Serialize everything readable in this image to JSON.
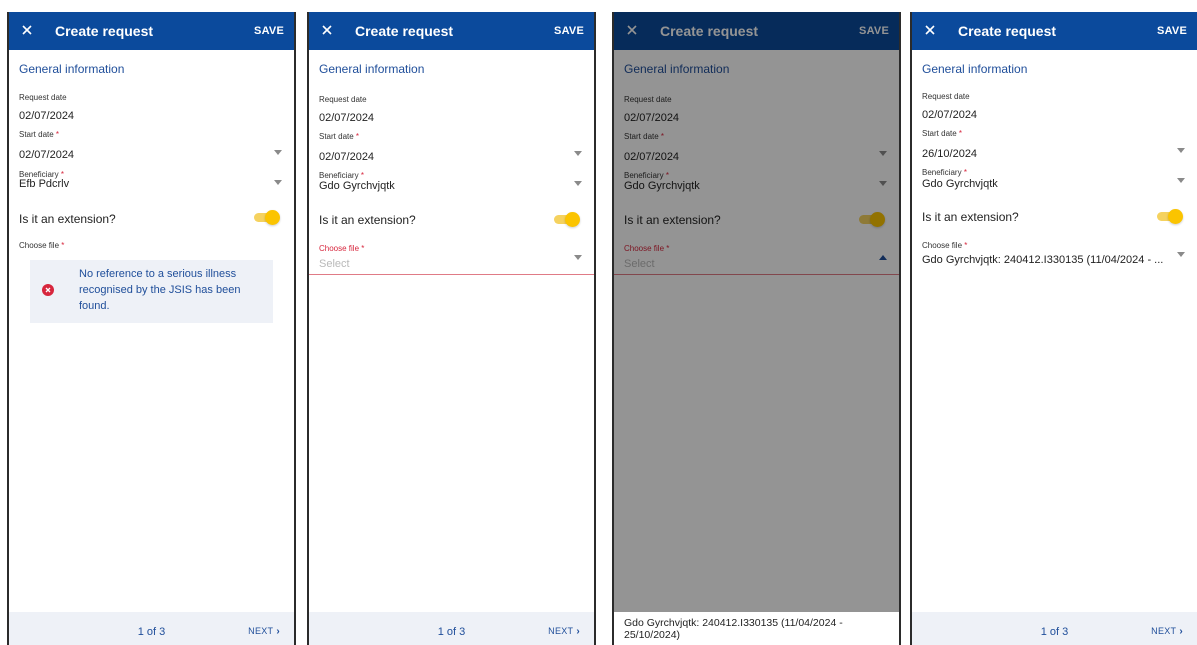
{
  "colors": {
    "header": "#0b4a9c",
    "accent_blue": "#1f4e9a",
    "required": "#d7263d",
    "toggle_on": "#fbc400",
    "error_icon": "#d7263d",
    "footer_bg": "#eef1f7"
  },
  "icons": {
    "close": "close-icon",
    "dropdown": "chevron-down-icon",
    "dropdown_open": "chevron-up-icon",
    "error": "error-circle-icon",
    "next": "chevron-right-icon"
  },
  "panels": [
    {
      "header": {
        "title": "Create request",
        "save_label": "SAVE"
      },
      "section_title": "General information",
      "request_date": {
        "label": "Request date",
        "value": "02/07/2024"
      },
      "start_date": {
        "label": "Start date",
        "required_mark": "*",
        "value": "02/07/2024"
      },
      "beneficiary": {
        "label": "Beneficiary",
        "required_mark": "*",
        "value": "Efb Pdcrlv"
      },
      "extension": {
        "label": "Is it an extension?",
        "on": true
      },
      "choose_file": {
        "label": "Choose file",
        "required_mark": "*"
      },
      "error_message": "No reference to a serious illness recognised by the JSIS has been found.",
      "footer": {
        "page": "1 of 3",
        "next_label": "NEXT"
      }
    },
    {
      "header": {
        "title": "Create request",
        "save_label": "SAVE"
      },
      "section_title": "General information",
      "request_date": {
        "label": "Request date",
        "value": "02/07/2024"
      },
      "start_date": {
        "label": "Start date",
        "required_mark": "*",
        "value": "02/07/2024"
      },
      "beneficiary": {
        "label": "Beneficiary",
        "required_mark": "*",
        "value": "Gdo Gyrchvjqtk"
      },
      "extension": {
        "label": "Is it an extension?",
        "on": true
      },
      "choose_file": {
        "label": "Choose file",
        "required_mark": "*",
        "placeholder": "Select"
      },
      "footer": {
        "page": "1 of 3",
        "next_label": "NEXT"
      }
    },
    {
      "header": {
        "title": "Create request",
        "save_label": "SAVE"
      },
      "section_title": "General information",
      "request_date": {
        "label": "Request date",
        "value": "02/07/2024"
      },
      "start_date": {
        "label": "Start date",
        "required_mark": "*",
        "value": "02/07/2024"
      },
      "beneficiary": {
        "label": "Beneficiary",
        "required_mark": "*",
        "value": "Gdo Gyrchvjqtk"
      },
      "extension": {
        "label": "Is it an extension?",
        "on": true
      },
      "choose_file": {
        "label": "Choose file",
        "required_mark": "*",
        "placeholder": "Select"
      },
      "dropdown_option": "Gdo Gyrchvjqtk: 240412.I330135 (11/04/2024 - 25/10/2024)"
    },
    {
      "header": {
        "title": "Create request",
        "save_label": "SAVE"
      },
      "section_title": "General information",
      "request_date": {
        "label": "Request date",
        "value": "02/07/2024"
      },
      "start_date": {
        "label": "Start date",
        "required_mark": "*",
        "value": "26/10/2024"
      },
      "beneficiary": {
        "label": "Beneficiary",
        "required_mark": "*",
        "value": "Gdo Gyrchvjqtk"
      },
      "extension": {
        "label": "Is it an extension?",
        "on": true
      },
      "choose_file": {
        "label": "Choose file",
        "required_mark": "*",
        "value": "Gdo Gyrchvjqtk: 240412.I330135 (11/04/2024 - ..."
      },
      "footer": {
        "page": "1 of 3",
        "next_label": "NEXT"
      }
    }
  ]
}
